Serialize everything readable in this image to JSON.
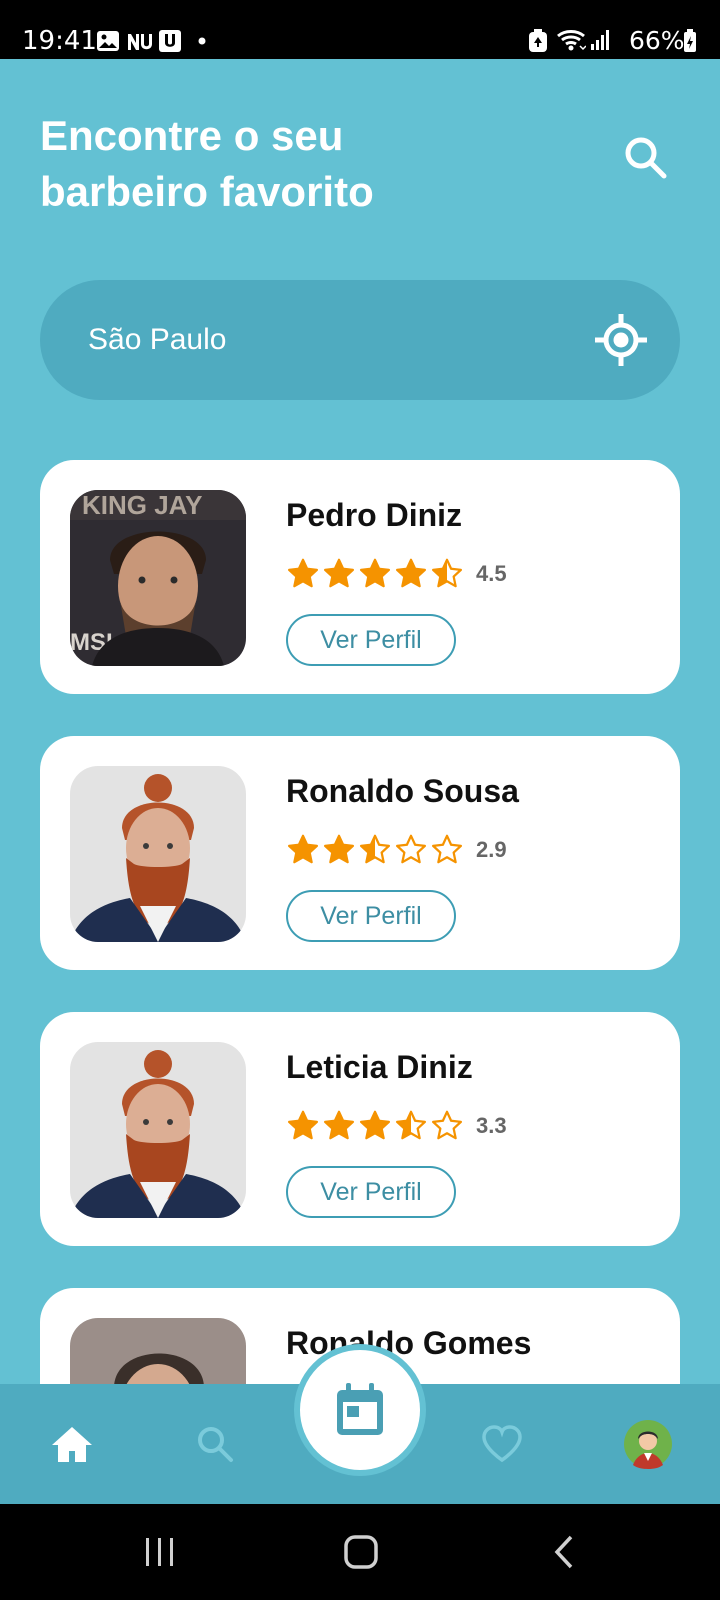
{
  "status_bar": {
    "time": "19:41",
    "battery_percent": "66%",
    "left_icons": [
      "gallery-icon",
      "nubank-icon",
      "uber-icon",
      "dot-icon"
    ],
    "right_icons": [
      "battery-saver-icon",
      "wifi-icon",
      "signal-icon",
      "battery-icon"
    ]
  },
  "header": {
    "title": "Encontre o seu\nbarbeiro favorito",
    "search_icon": "search-icon"
  },
  "location": {
    "city": "São Paulo",
    "locate_icon": "gps-locate-icon"
  },
  "barbers": [
    {
      "name": "Pedro Diniz",
      "rating": "4.5",
      "rating_value": 4.5,
      "button": "Ver Perfil"
    },
    {
      "name": "Ronaldo Sousa",
      "rating": "2.9",
      "rating_value": 2.9,
      "button": "Ver Perfil"
    },
    {
      "name": "Leticia Diniz",
      "rating": "3.3",
      "rating_value": 3.3,
      "button": "Ver Perfil"
    },
    {
      "name": "Ronaldo Gomes"
    }
  ],
  "bottom_nav": {
    "items": [
      "home-icon",
      "search-icon",
      "calendar-icon",
      "heart-icon",
      "profile-avatar"
    ],
    "active": "home-icon"
  },
  "colors": {
    "background": "#63c1d3",
    "nav_background": "#4fabc0",
    "star": "#f59300",
    "accent": "#3d9db4"
  }
}
